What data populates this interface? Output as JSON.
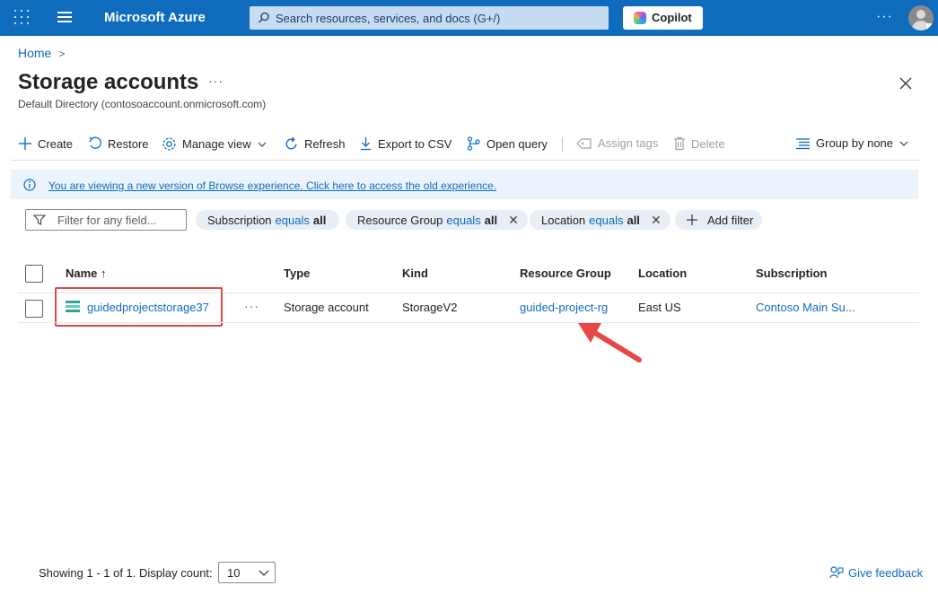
{
  "topbar": {
    "brand": "Microsoft Azure",
    "search_placeholder": "Search resources, services, and docs (G+/)",
    "copilot_label": "Copilot",
    "more_label": "···"
  },
  "breadcrumb": {
    "home": "Home",
    "separator": ">"
  },
  "page": {
    "title": "Storage accounts",
    "more_label": "···",
    "subtitle": "Default Directory (contosoaccount.onmicrosoft.com)"
  },
  "toolbar": {
    "create": "Create",
    "restore": "Restore",
    "manage_view": "Manage view",
    "refresh": "Refresh",
    "export_csv": "Export to CSV",
    "open_query": "Open query",
    "assign_tags": "Assign tags",
    "delete": "Delete",
    "group_by": "Group by none"
  },
  "banner": {
    "text": "You are viewing a new version of Browse experience. Click here to access the old experience."
  },
  "filters": {
    "input_placeholder": "Filter for any field...",
    "pills": [
      {
        "field": "Subscription",
        "op": "equals",
        "value": "all"
      },
      {
        "field": "Resource Group",
        "op": "equals",
        "value": "all",
        "x": "✕"
      },
      {
        "field": "Location",
        "op": "equals",
        "value": "all",
        "x": "✕"
      }
    ],
    "add_filter": "Add filter"
  },
  "table": {
    "headers": {
      "name": "Name ↑",
      "type": "Type",
      "kind": "Kind",
      "resource_group": "Resource Group",
      "location": "Location",
      "subscription": "Subscription"
    },
    "rows": [
      {
        "name": "guidedprojectstorage37",
        "more": "···",
        "type": "Storage account",
        "kind": "StorageV2",
        "resource_group": "guided-project-rg",
        "location": "East US",
        "subscription": "Contoso Main Su..."
      }
    ]
  },
  "footer": {
    "showing": "Showing 1 - 1 of 1. Display count:",
    "display_count": "10",
    "feedback": "Give feedback"
  },
  "colors": {
    "topbar": "#0f6cbd",
    "link": "#0f6cbd",
    "highlight": "#e04848",
    "banner": "#ebf3fc"
  }
}
